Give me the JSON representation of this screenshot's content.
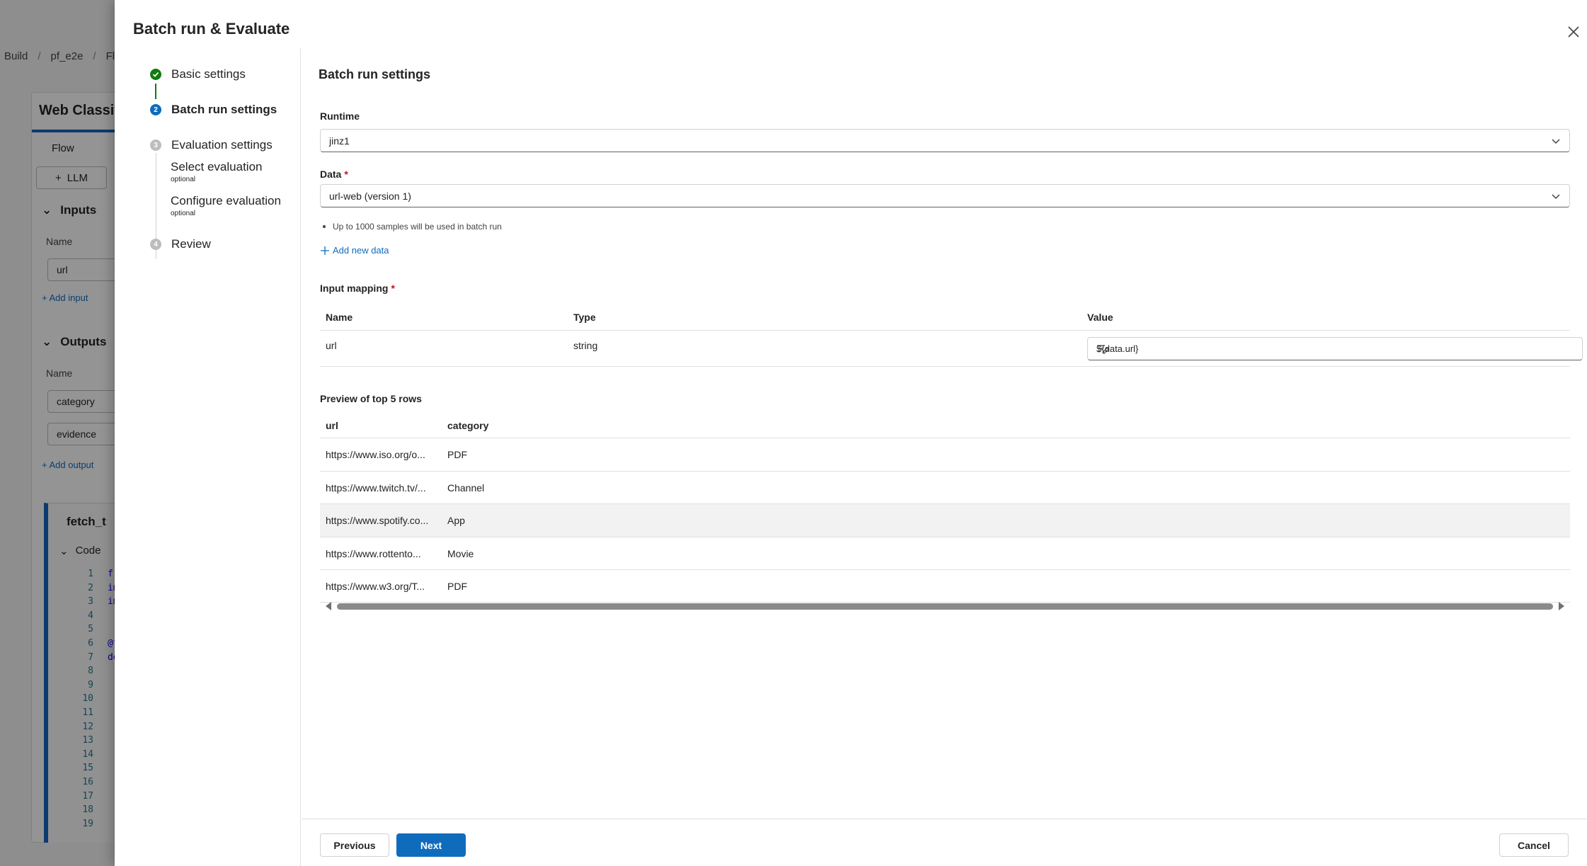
{
  "background": {
    "breadcrumb": [
      "Build",
      "pf_e2e",
      "Flow"
    ],
    "flow_title": "Web Classific",
    "tab_label": "Flow",
    "llm_button": "LLM",
    "inputs_header": "Inputs",
    "inputs_name_label": "Name",
    "input_field": "url",
    "add_input": "Add input",
    "outputs_header": "Outputs",
    "outputs_name_label": "Name",
    "output_fields": [
      "category",
      "evidence"
    ],
    "add_output": "Add output",
    "node_title": "fetch_t",
    "code_label": "Code",
    "code_line_numbers": [
      "1",
      "2",
      "3",
      "4",
      "5",
      "6",
      "7",
      "8",
      "9",
      "10",
      "11",
      "12",
      "13",
      "14",
      "15",
      "16",
      "17",
      "18",
      "19"
    ],
    "code_lines": [
      "fr",
      "im",
      "im",
      "",
      "",
      "@t",
      "de"
    ]
  },
  "dialog": {
    "title": "Batch run & Evaluate",
    "steps": [
      {
        "label": "Basic settings",
        "marker": "",
        "state": "done"
      },
      {
        "label": "Batch run settings",
        "marker": "2",
        "state": "current"
      },
      {
        "label": "Evaluation settings",
        "marker": "3",
        "state": "todo"
      },
      {
        "label": "Review",
        "marker": "4",
        "state": "todo"
      }
    ],
    "substeps": [
      {
        "label": "Select evaluation",
        "optional": "optional"
      },
      {
        "label": "Configure evaluation",
        "optional": "optional"
      }
    ],
    "section_title": "Batch run settings",
    "runtime": {
      "label": "Runtime",
      "value": "jinz1"
    },
    "data": {
      "label": "Data",
      "required": "*",
      "value": "url-web (version 1)",
      "note": "Up to 1000 samples will be used in batch run",
      "add_link": "Add new data"
    },
    "input_mapping": {
      "label": "Input mapping",
      "required": "*",
      "columns": [
        "Name",
        "Type",
        "Value"
      ],
      "row": {
        "name": "url",
        "type": "string",
        "value": "${data.url}"
      }
    },
    "preview": {
      "title": "Preview of top 5 rows",
      "columns": [
        "url",
        "category"
      ],
      "rows": [
        {
          "url": "https://www.iso.org/o...",
          "category": "PDF"
        },
        {
          "url": "https://www.twitch.tv/...",
          "category": "Channel"
        },
        {
          "url": "https://www.spotify.co...",
          "category": "App"
        },
        {
          "url": "https://www.rottento...",
          "category": "Movie"
        },
        {
          "url": "https://www.w3.org/T...",
          "category": "PDF"
        }
      ]
    },
    "footer": {
      "previous": "Previous",
      "next": "Next",
      "cancel": "Cancel"
    }
  }
}
